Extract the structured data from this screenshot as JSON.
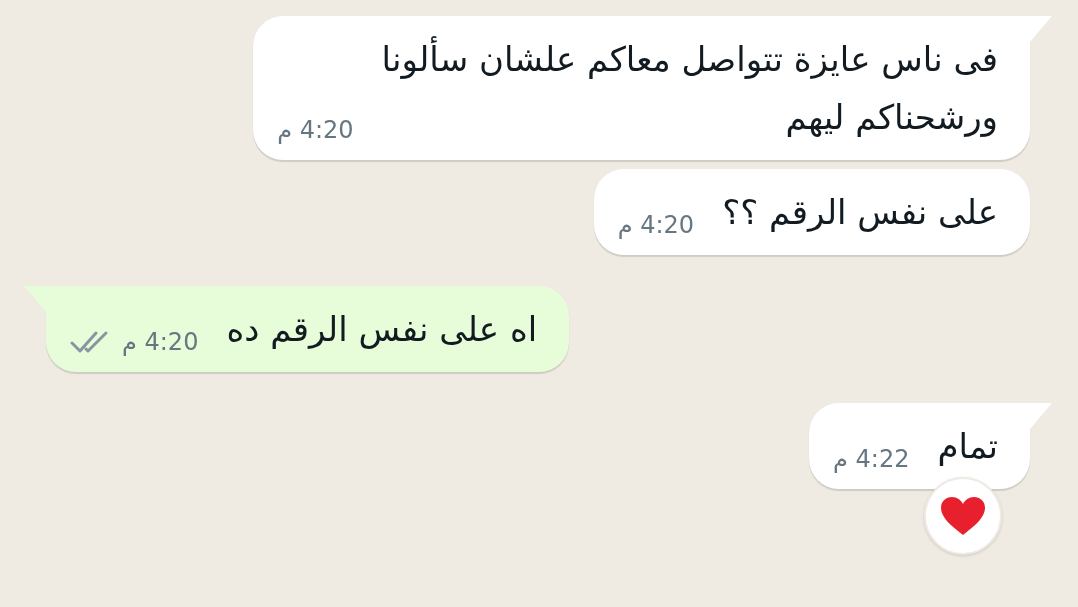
{
  "messages": [
    {
      "kind": "incoming",
      "tail": true,
      "text": "فى ناس عايزة تتواصل معاكم علشان سألونا\nورشحناكم ليهم",
      "time": "4:20 م"
    },
    {
      "kind": "incoming",
      "tail": false,
      "text": "على نفس الرقم ؟؟",
      "time": "4:20 م"
    },
    {
      "kind": "outgoing",
      "tail": true,
      "text": "اه على نفس الرقم ده",
      "time": "4:20 م",
      "delivered": true
    },
    {
      "kind": "incoming",
      "tail": true,
      "text": "تمام",
      "time": "4:22 م",
      "reacted": true
    }
  ]
}
